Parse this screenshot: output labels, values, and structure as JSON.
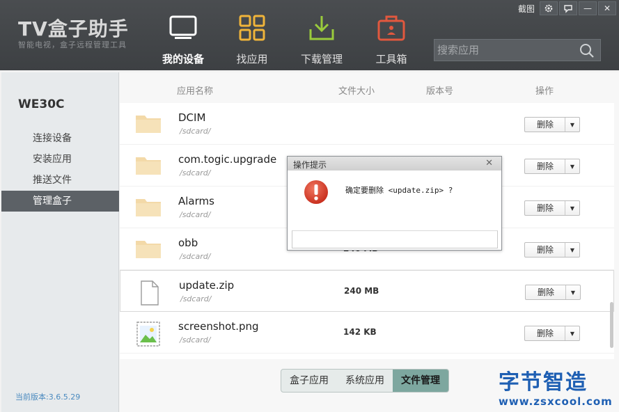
{
  "app": {
    "title": "TV盒子助手",
    "subtitle": "智能电视，盒子远程管理工具"
  },
  "titlebar": {
    "screenshot_label": "截图",
    "settings_icon": "gear-icon",
    "feedback_icon": "chat-icon",
    "minimize_label": "—",
    "close_label": "✕"
  },
  "nav": [
    {
      "label": "我的设备",
      "icon": "tv-icon",
      "active": true
    },
    {
      "label": "找应用",
      "icon": "grid-icon",
      "active": false
    },
    {
      "label": "下载管理",
      "icon": "download-icon",
      "active": false
    },
    {
      "label": "工具箱",
      "icon": "toolbox-icon",
      "active": false
    }
  ],
  "search": {
    "placeholder": "搜索应用",
    "value": ""
  },
  "sidebar": {
    "device_name": "WE30C",
    "items": [
      {
        "label": "连接设备",
        "active": false
      },
      {
        "label": "安装应用",
        "active": false
      },
      {
        "label": "推送文件",
        "active": false
      },
      {
        "label": "管理盒子",
        "active": true
      }
    ],
    "version": "当前版本:3.6.5.29"
  },
  "table": {
    "headers": [
      "应用名称",
      "文件大小",
      "版本号",
      "操作"
    ],
    "rows": [
      {
        "name": "DCIM",
        "path": "/sdcard/",
        "size": "",
        "icon": "folder-icon",
        "action": "删除"
      },
      {
        "name": "com.togic.upgrade",
        "path": "/sdcard/",
        "size": "",
        "icon": "folder-icon",
        "action": "删除"
      },
      {
        "name": "Alarms",
        "path": "/sdcard/",
        "size": "",
        "icon": "folder-icon",
        "action": "删除"
      },
      {
        "name": "obb",
        "path": "/sdcard/",
        "size": "240 MB",
        "icon": "folder-icon",
        "action": "删除"
      },
      {
        "name": "update.zip",
        "path": "/sdcard/",
        "size": "240 MB",
        "icon": "file-icon",
        "action": "删除"
      },
      {
        "name": "screenshot.png",
        "path": "/sdcard/",
        "size": "142 KB",
        "icon": "image-file-icon",
        "action": "删除"
      }
    ]
  },
  "tabs": [
    {
      "label": "盒子应用",
      "active": false
    },
    {
      "label": "系统应用",
      "active": false
    },
    {
      "label": "文件管理",
      "active": true
    }
  ],
  "dialog": {
    "title": "操作提示",
    "message": "确定要删除 <update.zip> ?",
    "close_label": "✕",
    "icon": "warning-icon"
  },
  "watermark": {
    "text": "字节智造",
    "url": "www.zsxcool.com"
  },
  "colors": {
    "header_bg": "#43464a",
    "sidebar_active": "#5c6166",
    "tab_active": "#7da79f",
    "warning_red": "#e2493b",
    "folder": "#f3d9a8"
  }
}
